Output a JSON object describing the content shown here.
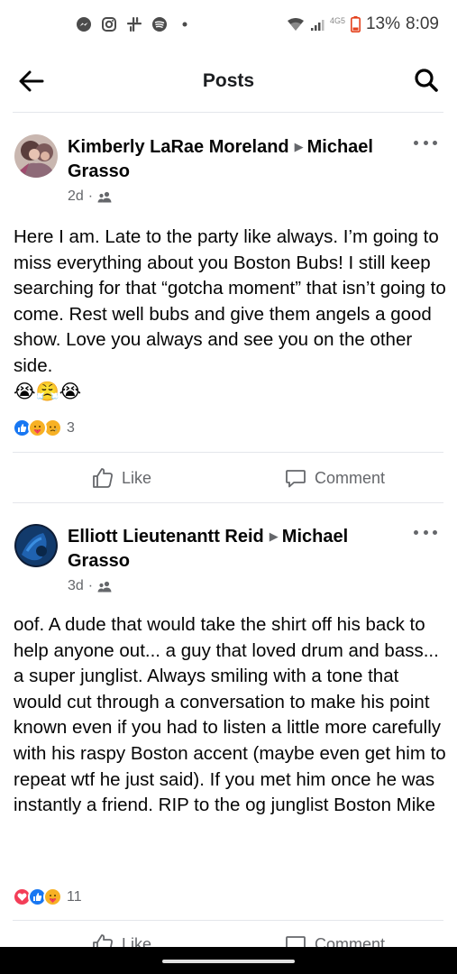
{
  "status_bar": {
    "icons": [
      "messenger-icon",
      "instagram-icon",
      "slack-icon",
      "spotify-icon",
      "dot-icon",
      "wifi-icon",
      "signal-icon"
    ],
    "network": "4G5",
    "battery": "13%",
    "time": "8:09"
  },
  "header": {
    "title": "Posts"
  },
  "posts": [
    {
      "author": "Kimberly LaRae Moreland",
      "recipient": "Michael Grasso",
      "time": "2d",
      "separator": "·",
      "text": "Here I am. Late to the party like always. I’m going to miss everything about you Boston Bubs! I still keep searching for that “gotcha moment” that isn’t going to come. Rest well bubs and give them angels a good show. Love you always and see you on the other side.",
      "emojis": "😭😤😭",
      "reactions": [
        "like",
        "care",
        "sad"
      ],
      "reaction_count": "3",
      "like_label": "Like",
      "comment_label": "Comment"
    },
    {
      "author": "Elliott Lieutenantt Reid",
      "recipient": "Michael Grasso",
      "time": "3d",
      "separator": "·",
      "text": "oof.  A dude that would take the shirt off his back to help anyone out... a guy that loved drum and bass... a super junglist.  Always smiling with a tone that would cut through a conversation to make his point known even if you had to listen a little more carefully with his raspy Boston accent (maybe even get him to repeat wtf he just said). If you met him once he was instantly a friend.  RIP to the og junglist Boston Mike",
      "reactions": [
        "love",
        "like",
        "care"
      ],
      "reaction_count": "11",
      "like_label": "Like",
      "comment_label": "Comment"
    }
  ],
  "colors": {
    "like_blue": "#1877f2",
    "love_red": "#f33e58",
    "care_yellow": "#f7b125",
    "secondary_text": "#65676b",
    "divider": "#e4e6eb"
  }
}
